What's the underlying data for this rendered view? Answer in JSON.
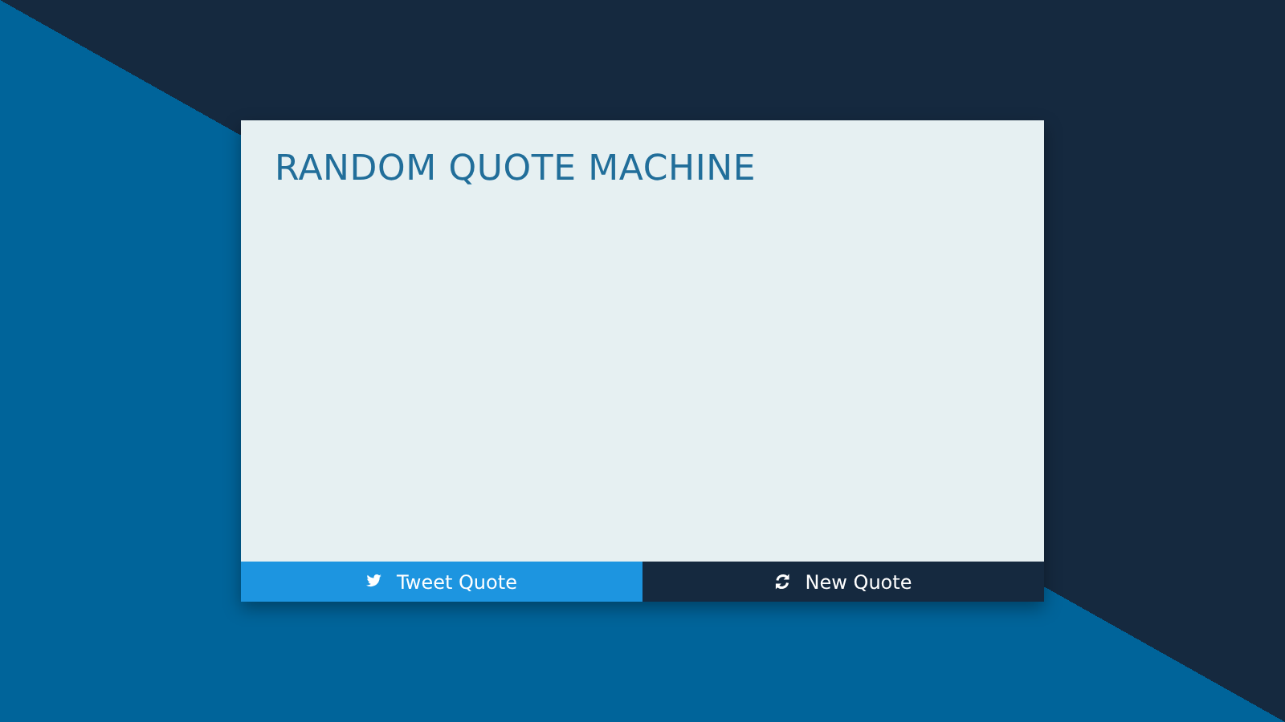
{
  "title": "RANDOM QUOTE MACHINE",
  "buttons": [
    {
      "kind": "tweet",
      "label": "Tweet Quote"
    },
    {
      "kind": "refresh",
      "label": "New Quote"
    }
  ]
}
